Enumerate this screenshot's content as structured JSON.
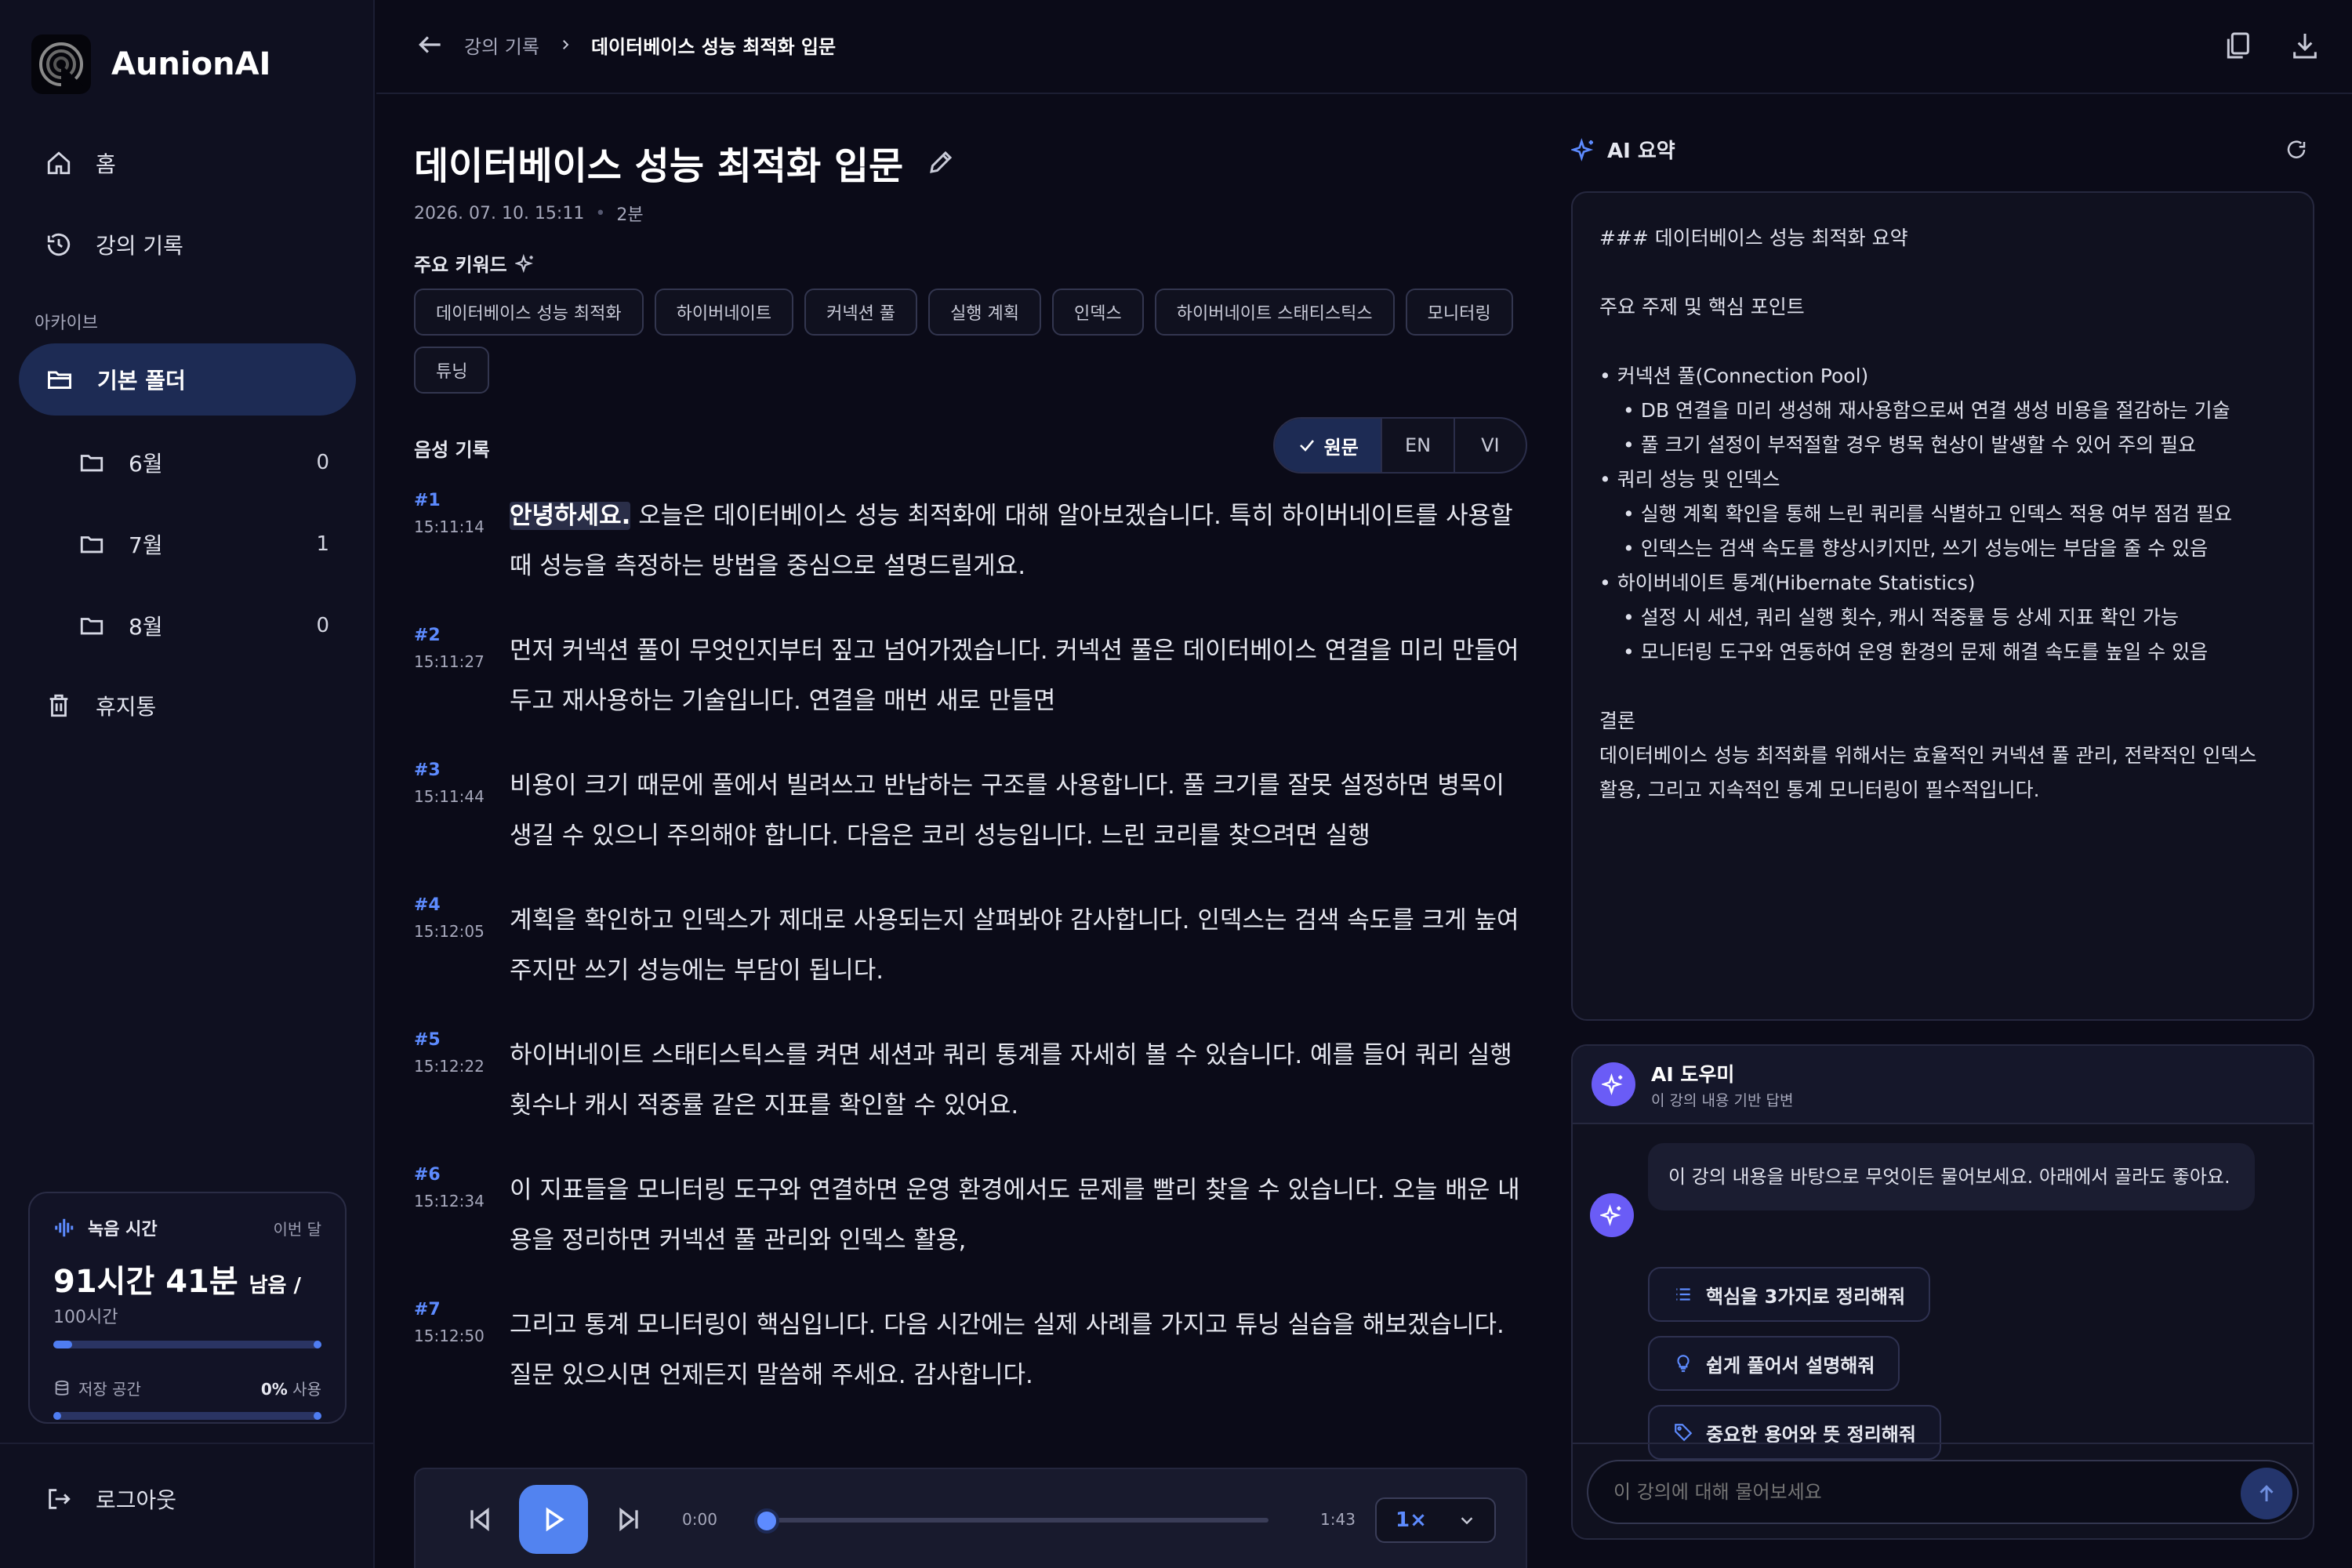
{
  "app": {
    "name": "AunionAI"
  },
  "sidebar": {
    "home": "홈",
    "history": "강의 기록",
    "archive_label": "아카이브",
    "default_folder": "기본 폴더",
    "folders": [
      {
        "name": "6월",
        "count": "0"
      },
      {
        "name": "7월",
        "count": "1"
      },
      {
        "name": "8월",
        "count": "0"
      }
    ],
    "trash": "휴지통",
    "logout": "로그아웃"
  },
  "usage": {
    "title": "녹음 시간",
    "period": "이번 달",
    "remaining": "91시간 41분",
    "remaining_suffix": "남음 /",
    "total": "100시간",
    "storage_label": "저장 공간",
    "storage_pct": "0%",
    "storage_suffix": " 사용"
  },
  "breadcrumb": {
    "parent": "강의 기록",
    "current": "데이터베이스 성능 최적화 입문"
  },
  "lecture": {
    "title": "데이터베이스 성능 최적화 입문",
    "date": "2026. 07. 10. 15:11",
    "duration": "2분",
    "keywords_label": "주요 키워드",
    "keywords": [
      "데이터베이스 성능 최적화",
      "하이버네이트",
      "커넥션 풀",
      "실행 계획",
      "인덱스",
      "하이버네이트 스태티스틱스",
      "모니터링",
      "튜닝"
    ]
  },
  "transcript": {
    "label": "음성 기록",
    "langs": [
      "원문",
      "EN",
      "VI"
    ],
    "segments": [
      {
        "num": "#1",
        "time": "15:11:14",
        "highlight": "안녕하세요.",
        "text": " 오늘은 데이터베이스 성능 최적화에 대해 알아보겠습니다. 특히 하이버네이트를 사용할 때 성능을 측정하는 방법을 중심으로 설명드릴게요."
      },
      {
        "num": "#2",
        "time": "15:11:27",
        "highlight": "",
        "text": "먼저 커넥션 풀이 무엇인지부터 짚고 넘어가겠습니다. 커넥션 풀은 데이터베이스 연결을 미리 만들어두고 재사용하는 기술입니다. 연결을 매번 새로 만들면"
      },
      {
        "num": "#3",
        "time": "15:11:44",
        "highlight": "",
        "text": "비용이 크기 때문에 풀에서 빌려쓰고 반납하는 구조를 사용합니다. 풀 크기를 잘못 설정하면 병목이 생길 수 있으니 주의해야 합니다. 다음은 코리 성능입니다. 느린 코리를 찾으려면 실행"
      },
      {
        "num": "#4",
        "time": "15:12:05",
        "highlight": "",
        "text": "계획을 확인하고 인덱스가 제대로 사용되는지 살펴봐야 감사합니다. 인덱스는 검색 속도를 크게 높여주지만 쓰기 성능에는 부담이 됩니다."
      },
      {
        "num": "#5",
        "time": "15:12:22",
        "highlight": "",
        "text": "하이버네이트 스태티스틱스를 켜면 세션과 쿼리 통계를 자세히 볼 수 있습니다. 예를 들어 쿼리 실행 횟수나 캐시 적중률 같은 지표를 확인할 수 있어요."
      },
      {
        "num": "#6",
        "time": "15:12:34",
        "highlight": "",
        "text": "이 지표들을 모니터링 도구와 연결하면 운영 환경에서도 문제를 빨리 찾을 수 있습니다. 오늘 배운 내용을 정리하면 커넥션 풀 관리와 인덱스 활용,"
      },
      {
        "num": "#7",
        "time": "15:12:50",
        "highlight": "",
        "text": "그리고 통계 모니터링이 핵심입니다. 다음 시간에는 실제 사례를 가지고 튜닝 실습을 해보겠습니다. 질문 있으시면 언제든지 말씀해 주세요. 감사합니다."
      }
    ]
  },
  "player": {
    "current": "0:00",
    "total": "1:43",
    "speed": "1×",
    "progress": 0
  },
  "summary": {
    "title": "AI 요약",
    "lines": [
      {
        "t": "### 데이터베이스 성능 최적화 요약",
        "indent": false
      },
      {
        "t": "",
        "indent": false
      },
      {
        "t": "주요 주제 및 핵심 포인트",
        "indent": false
      },
      {
        "t": "",
        "indent": false
      },
      {
        "t": "• 커넥션 풀(Connection Pool)",
        "indent": false
      },
      {
        "t": "• DB 연결을 미리 생성해 재사용함으로써 연결 생성 비용을 절감하는 기술",
        "indent": true
      },
      {
        "t": "• 풀 크기 설정이 부적절할 경우 병목 현상이 발생할 수 있어 주의 필요",
        "indent": true
      },
      {
        "t": "• 쿼리 성능 및 인덱스",
        "indent": false
      },
      {
        "t": "• 실행 계획 확인을 통해 느린 쿼리를 식별하고 인덱스 적용 여부 점검 필요",
        "indent": true
      },
      {
        "t": "• 인덱스는 검색 속도를 향상시키지만, 쓰기 성능에는 부담을 줄 수 있음",
        "indent": true
      },
      {
        "t": "• 하이버네이트 통계(Hibernate Statistics)",
        "indent": false
      },
      {
        "t": "• 설정 시 세션, 쿼리 실행 횟수, 캐시 적중률 등 상세 지표 확인 가능",
        "indent": true
      },
      {
        "t": "• 모니터링 도구와 연동하여 운영 환경의 문제 해결 속도를 높일 수 있음",
        "indent": true
      },
      {
        "t": "",
        "indent": false
      },
      {
        "t": "결론",
        "indent": false
      },
      {
        "t": "데이터베이스 성능 최적화를 위해서는 효율적인 커넥션 풀 관리, 전략적인 인덱스",
        "indent": false
      },
      {
        "t": "활용, 그리고 지속적인 통계 모니터링이 필수적입니다.",
        "indent": false
      }
    ]
  },
  "assistant": {
    "title": "AI 도우미",
    "subtitle": "이 강의 내용 기반 답변",
    "greeting": "이 강의 내용을 바탕으로 무엇이든 물어보세요. 아래에서 골라도 좋아요.",
    "suggestions": [
      "핵심을 3가지로 정리해줘",
      "쉽게 풀어서 설명해줘",
      "중요한 용어와 뜻 정리해줘"
    ],
    "placeholder": "이 강의에 대해 물어보세요"
  },
  "colors": {
    "accent": "#5283f0",
    "active_bg": "#1d2b54",
    "bg": "#0b0b18"
  }
}
